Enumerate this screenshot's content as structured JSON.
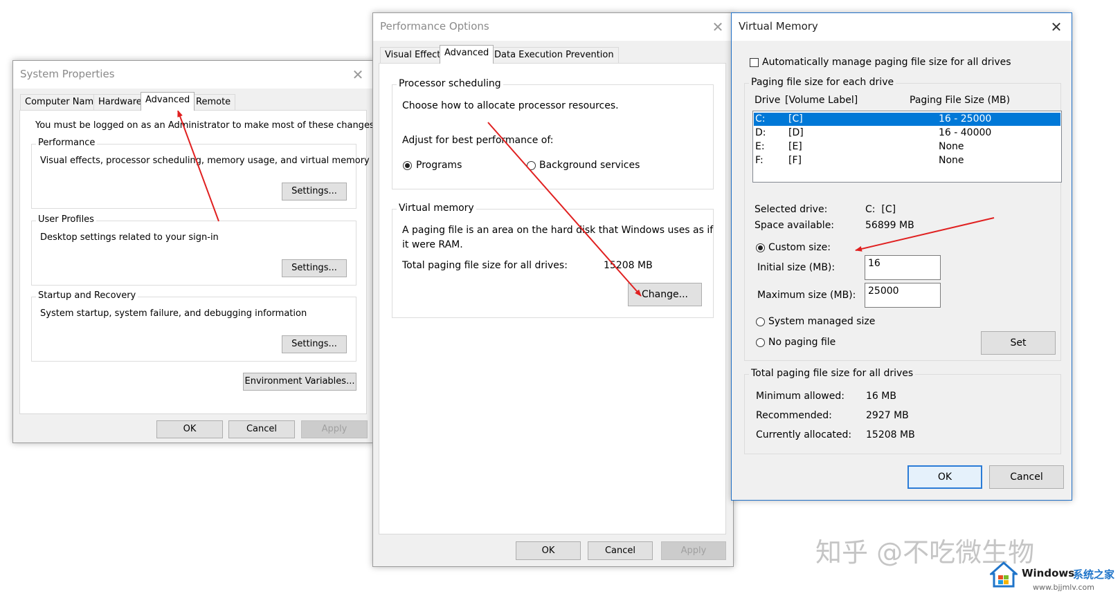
{
  "system_properties": {
    "title": "System Properties",
    "tabs": [
      "Computer Name",
      "Hardware",
      "Advanced",
      "Remote"
    ],
    "admin_note": "You must be logged on as an Administrator to make most of these changes.",
    "performance": {
      "legend": "Performance",
      "desc": "Visual effects, processor scheduling, memory usage, and virtual memory",
      "button": "Settings..."
    },
    "user_profiles": {
      "legend": "User Profiles",
      "desc": "Desktop settings related to your sign-in",
      "button": "Settings..."
    },
    "startup": {
      "legend": "Startup and Recovery",
      "desc": "System startup, system failure, and debugging information",
      "button": "Settings..."
    },
    "env_button": "Environment Variables...",
    "ok": "OK",
    "cancel": "Cancel",
    "apply": "Apply"
  },
  "performance_options": {
    "title": "Performance Options",
    "tabs": [
      "Visual Effects",
      "Advanced",
      "Data Execution Prevention"
    ],
    "processor": {
      "legend": "Processor scheduling",
      "desc": "Choose how to allocate processor resources.",
      "adjust": "Adjust for best performance of:",
      "programs": "Programs",
      "background": "Background services"
    },
    "virtual_memory": {
      "legend": "Virtual memory",
      "desc_line1": "A paging file is an area on the hard disk that Windows uses as if",
      "desc_line2": "it were RAM.",
      "total_label": "Total paging file size for all drives:",
      "total_value": "15208 MB",
      "change": "Change..."
    },
    "ok": "OK",
    "cancel": "Cancel",
    "apply": "Apply"
  },
  "virtual_memory": {
    "title": "Virtual Memory",
    "auto_manage": "Automatically manage paging file size for all drives",
    "each_drive_legend": "Paging file size for each drive",
    "col_drive": "Drive",
    "col_label": "[Volume Label]",
    "col_size": "Paging File Size (MB)",
    "drives": [
      {
        "drive": "C:",
        "label": "[C]",
        "size": "16 - 25000"
      },
      {
        "drive": "D:",
        "label": "[D]",
        "size": "16 - 40000"
      },
      {
        "drive": "E:",
        "label": "[E]",
        "size": "None"
      },
      {
        "drive": "F:",
        "label": "[F]",
        "size": "None"
      }
    ],
    "selected_drive_label": "Selected drive:",
    "selected_drive_value": "C:  [C]",
    "space_label": "Space available:",
    "space_value": "56899 MB",
    "custom_size": "Custom size:",
    "initial_label": "Initial size (MB):",
    "initial_value": "16",
    "max_label": "Maximum size (MB):",
    "max_value": "25000",
    "system_managed": "System managed size",
    "no_paging": "No paging file",
    "set": "Set",
    "totals_legend": "Total paging file size for all drives",
    "min_label": "Minimum allowed:",
    "min_value": "16 MB",
    "rec_label": "Recommended:",
    "rec_value": "2927 MB",
    "cur_label": "Currently allocated:",
    "cur_value": "15208 MB",
    "ok": "OK",
    "cancel": "Cancel"
  },
  "watermark": {
    "zhihu": "知乎 @不吃微生物",
    "windows": "Windows",
    "windows_cn": "系统之家",
    "url": "www.bjjmlv.com"
  },
  "colors": {
    "accent": "#0078d7",
    "arrow": "#e02020"
  }
}
